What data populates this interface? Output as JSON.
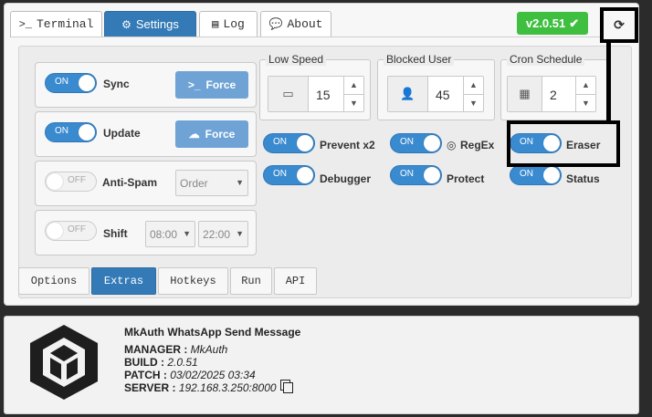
{
  "tabs": [
    {
      "label": "Terminal",
      "icon": ">_"
    },
    {
      "label": "Settings",
      "icon": "cogs-icon"
    },
    {
      "label": "Log",
      "icon": "list-icon"
    },
    {
      "label": "About",
      "icon": "comment-icon"
    }
  ],
  "active_tab": "Settings",
  "version_badge": "v2.0.51",
  "left_controls": [
    {
      "switch": "ON",
      "label": "Sync",
      "action": "Force",
      "action_icon": ">_"
    },
    {
      "switch": "ON",
      "label": "Update",
      "action": "Force",
      "action_icon": "cloud-download-icon"
    },
    {
      "switch": "OFF",
      "label": "Anti-Spam",
      "select": "Order"
    },
    {
      "switch": "OFF",
      "label": "Shift",
      "select_from": "08:00",
      "select_to": "22:00"
    }
  ],
  "numbers": [
    {
      "legend": "Low Speed",
      "value": "15",
      "icon": "battery-icon"
    },
    {
      "legend": "Blocked User",
      "value": "45",
      "icon": "user-times-icon"
    },
    {
      "legend": "Cron Schedule",
      "value": "2",
      "icon": "calendar-icon"
    }
  ],
  "toggles": [
    {
      "switch": "ON",
      "label": "Prevent x2"
    },
    {
      "switch": "ON",
      "label": "RegEx",
      "icon": "whatsapp-icon"
    },
    {
      "switch": "ON",
      "label": "Eraser"
    },
    {
      "switch": "ON",
      "label": "Debugger"
    },
    {
      "switch": "ON",
      "label": "Protect"
    },
    {
      "switch": "ON",
      "label": "Status"
    }
  ],
  "bottom_tabs": [
    "Options",
    "Extras",
    "Hotkeys",
    "Run",
    "API"
  ],
  "active_bottom_tab": "Extras",
  "info": {
    "title": "MkAuth WhatsApp Send Message",
    "manager_label": "MANAGER :",
    "manager_value": "MkAuth",
    "build_label": "BUILD :",
    "build_value": "2.0.51",
    "patch_label": "PATCH :",
    "patch_value": "03/02/2025 03:34",
    "server_label": "SERVER :",
    "server_value": "192.168.3.250:8000"
  },
  "colors": {
    "primary": "#337ab7",
    "switch_on": "#3a8ad0",
    "force_button": "#6fa3d6",
    "version_green": "#3fbf3f",
    "background": "#2b2b2b"
  }
}
